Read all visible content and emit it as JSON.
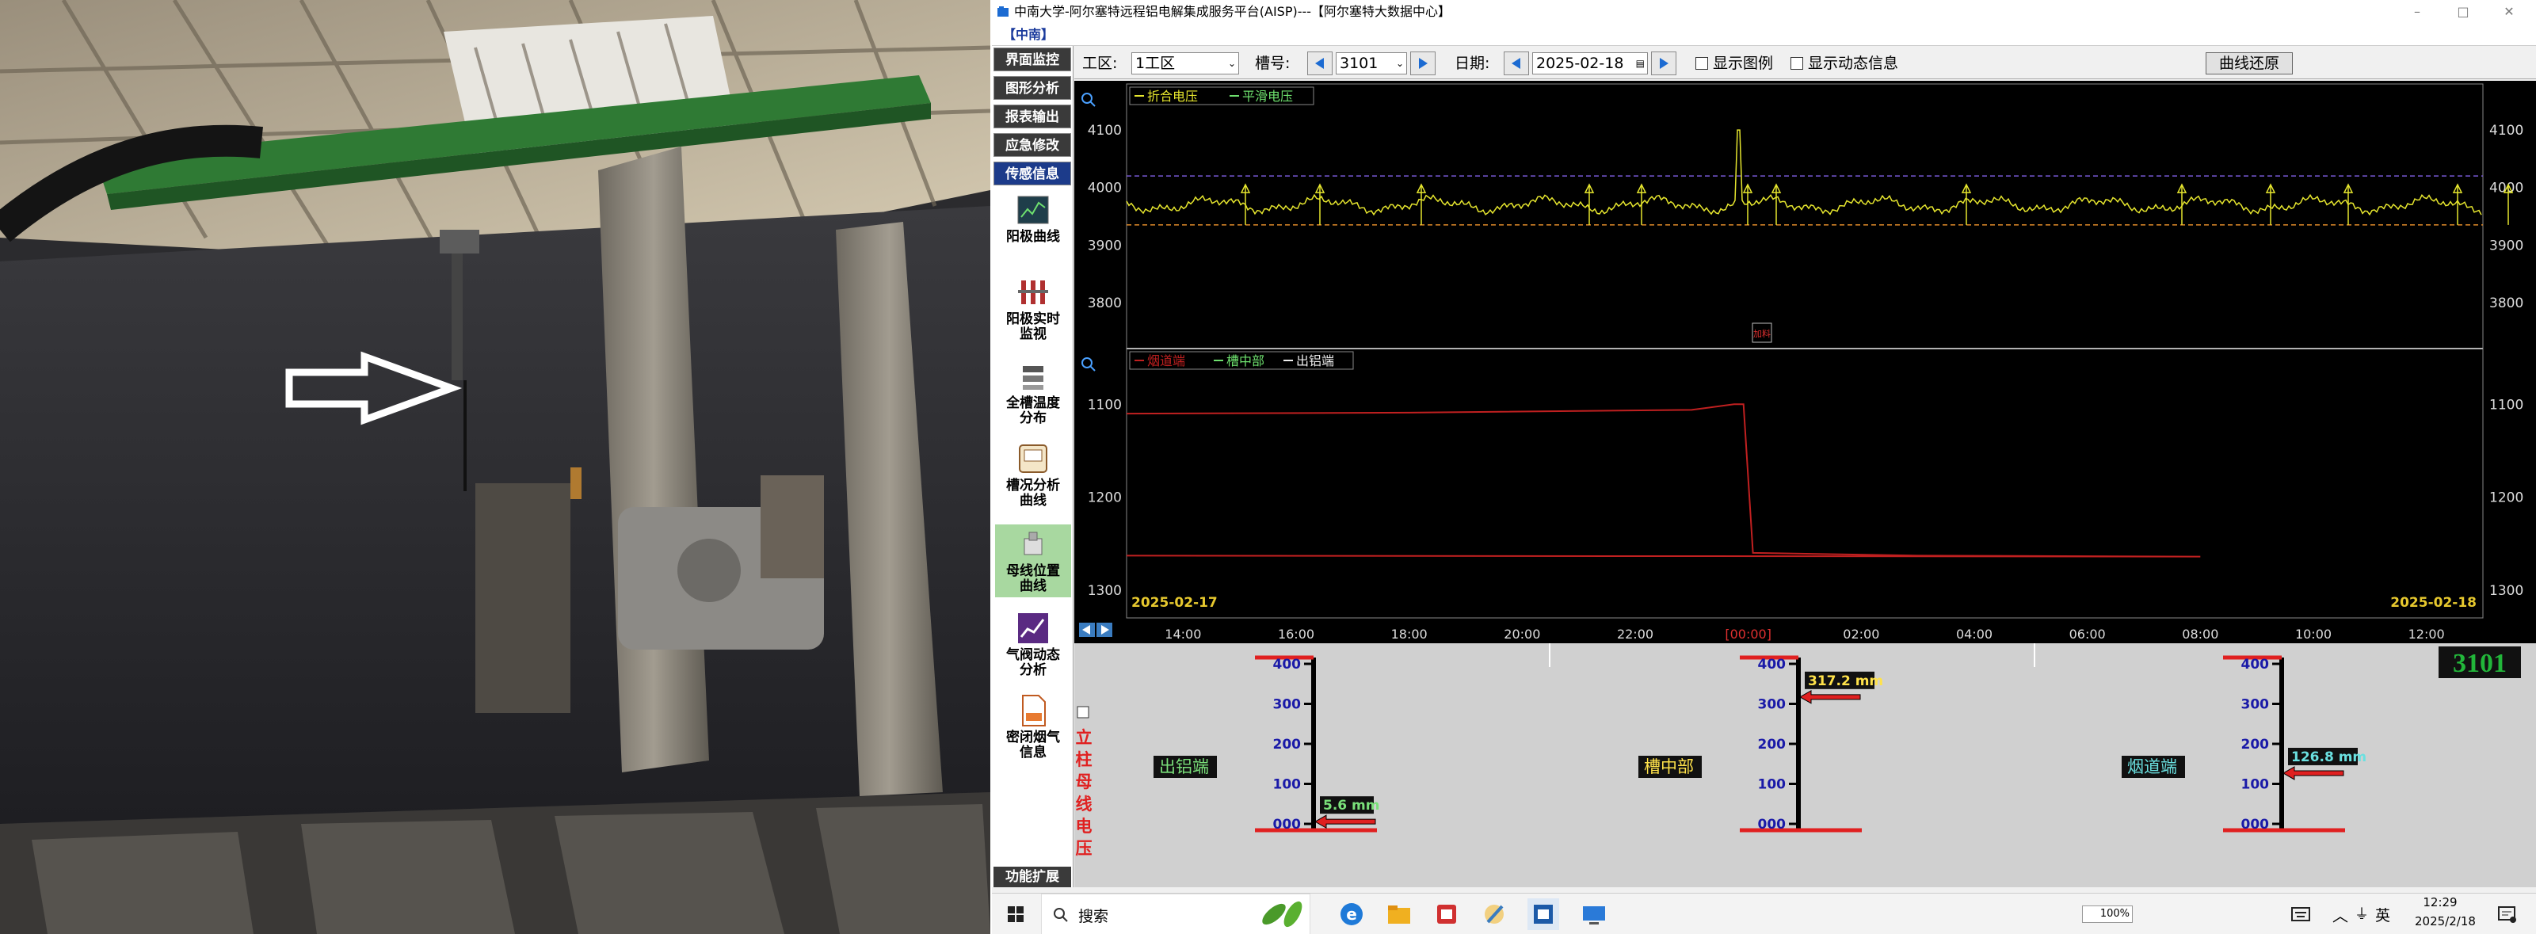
{
  "window": {
    "title": "中南大学-阿尔塞特远程铝电解集成服务平台(AISP)---【阿尔塞特大数据中心】",
    "min_glyph": "–",
    "max_glyph": "□",
    "close_glyph": "✕"
  },
  "brand": "【中南】",
  "sidebar": {
    "menu": [
      "界面监控",
      "图形分析",
      "报表输出",
      "应急修改",
      "传感信息"
    ],
    "active_index": 4,
    "tools": [
      {
        "label": "阳极曲线",
        "icon": "anode-curve-icon"
      },
      {
        "label": "阳极实时\n监视",
        "icon": "anode-realtime-icon"
      },
      {
        "label": "全槽温度\n分布",
        "icon": "temperature-icon"
      },
      {
        "label": "槽况分析\n曲线",
        "icon": "cell-analysis-icon"
      },
      {
        "label": "母线位置\n曲线",
        "icon": "busbar-position-icon"
      },
      {
        "label": "气阀动态\n分析",
        "icon": "valve-analysis-icon"
      },
      {
        "label": "密闭烟气\n信息",
        "icon": "flue-gas-icon"
      }
    ],
    "selected_tool": 4,
    "func_ext": "功能扩展"
  },
  "toolbar": {
    "area_label": "工区:",
    "area_value": "1工区",
    "cell_label": "槽号:",
    "cell_value": "3101",
    "date_label": "日期:",
    "date_value": "2025-02-18",
    "show_legend": "显示图例",
    "show_dynamic": "显示动态信息",
    "restore_button": "曲线还原"
  },
  "chart_data": [
    {
      "type": "line",
      "title": "",
      "legend": [
        "折合电压",
        "平滑电压"
      ],
      "y_ticks": [
        "4100",
        "4000",
        "3900",
        "3800"
      ],
      "ylim": [
        3720,
        4180
      ],
      "reference_lines": [
        4020,
        3935
      ],
      "marker_label": "加料",
      "series": [
        {
          "name": "折合电压",
          "color": "#e6e62e",
          "baseline": 3970,
          "spike": {
            "x": "23:50",
            "y": 4100
          }
        }
      ]
    },
    {
      "type": "line",
      "title": "",
      "legend": [
        "烟道端",
        "槽中部",
        "出铝端"
      ],
      "y_ticks": [
        "1100",
        "1200",
        "1300"
      ],
      "ylim": [
        1040,
        1330
      ],
      "start_date": "2025-02-17",
      "end_date": "2025-02-18",
      "x_ticks": [
        "14:00",
        "16:00",
        "18:00",
        "20:00",
        "22:00",
        "[00:00]",
        "02:00",
        "04:00",
        "06:00",
        "08:00",
        "10:00",
        "12:00"
      ],
      "series": [
        {
          "name": "烟道端",
          "color": "#c02020",
          "points": [
            [
              "13:00",
              1110
            ],
            [
              "18:00",
              1109
            ],
            [
              "23:00",
              1106
            ],
            [
              "23:45",
              1100
            ],
            [
              "23:55",
              1100
            ],
            [
              "00:05",
              1260
            ],
            [
              "03:00",
              1263
            ],
            [
              "08:00",
              1264
            ],
            [
              "13:00",
              1263
            ]
          ]
        }
      ]
    }
  ],
  "gauge_panel": {
    "cell_number": "3101",
    "side_label": "立柱母线电压",
    "scale_ticks": [
      "400",
      "300",
      "200",
      "100",
      "000"
    ],
    "gauges": [
      {
        "label": "出铝端",
        "value_mm": 5.6,
        "value_text": "5.6 mm"
      },
      {
        "label": "槽中部",
        "value_mm": 317.2,
        "value_text": "317.2 mm"
      },
      {
        "label": "烟道端",
        "value_mm": 126.8,
        "value_text": "126.8 mm"
      }
    ]
  },
  "taskbar": {
    "search_placeholder": "搜索",
    "battery": "100%",
    "ime": "英",
    "time": "12:29",
    "date": "2025/2/18"
  },
  "photo": {
    "description_colors": {
      "roof": "#c8b89a",
      "beam": "#3d8a3a",
      "wall": "#2a2a2c",
      "anode": "#8a8478"
    }
  }
}
